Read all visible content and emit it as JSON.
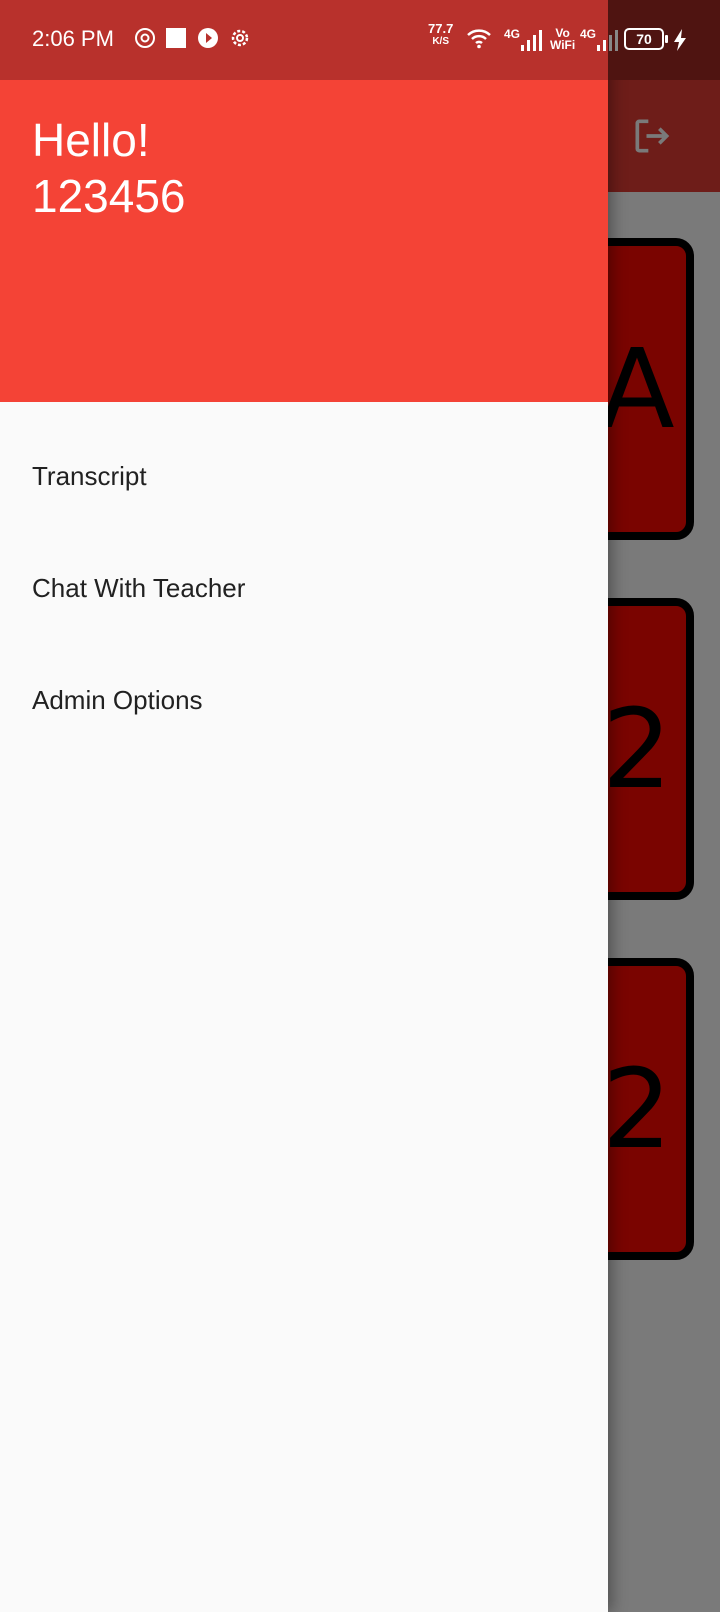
{
  "status_bar": {
    "time": "2:06 PM",
    "net_speed_value": "77.7",
    "net_speed_unit": "K/S",
    "network_1": "4G",
    "vowifi_top": "Vo",
    "vowifi_bottom": "WiFi",
    "network_2": "4G",
    "battery_level": "70"
  },
  "drawer": {
    "greeting": "Hello!",
    "user_id": "123456",
    "menu_items": [
      {
        "label": "Transcript"
      },
      {
        "label": "Chat With Teacher"
      },
      {
        "label": "Admin Options"
      }
    ]
  },
  "background": {
    "cards": [
      {
        "glyph": "A"
      },
      {
        "glyph": "2"
      },
      {
        "glyph": "2"
      }
    ],
    "appbar_icon": "logout-icon"
  },
  "colors": {
    "drawer_header": "#f44336",
    "status_bar": "#b8312c",
    "card_fill": "#7a0400"
  }
}
